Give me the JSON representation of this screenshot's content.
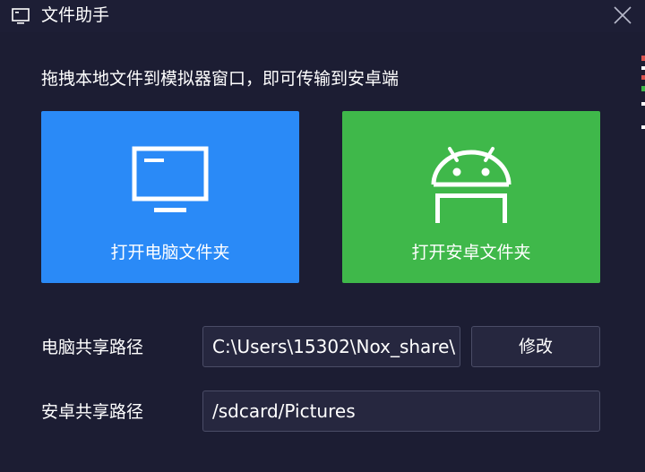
{
  "titlebar": {
    "title": "文件助手",
    "icon": "monitor-icon",
    "close_icon": "close-icon"
  },
  "instruction": "拖拽本地文件到模拟器窗口，即可传输到安卓端",
  "tiles": {
    "pc": {
      "label": "打开电脑文件夹",
      "icon": "monitor-icon",
      "color": "#2a8af7"
    },
    "android": {
      "label": "打开安卓文件夹",
      "icon": "android-icon",
      "color": "#3fb84a"
    }
  },
  "shared_paths": {
    "pc_label": "电脑共享路径",
    "pc_value": "C:\\Users\\15302\\Nox_share\\",
    "modify_label": "修改",
    "android_label": "安卓共享路径",
    "android_value": "/sdcard/Pictures"
  },
  "colors": {
    "background": "#1c1d33",
    "field_background": "#26273f",
    "field_border": "#4a4c66"
  }
}
